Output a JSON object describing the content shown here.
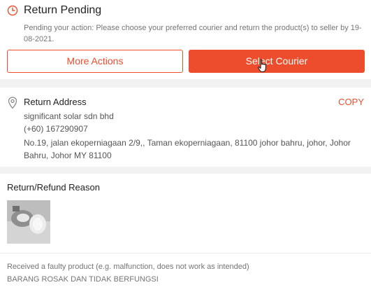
{
  "status": {
    "title": "Return Pending",
    "description": "Pending your action: Please choose your preferred courier and return the product(s) to seller by 19-08-2021.",
    "icon": "clock-icon"
  },
  "actions": {
    "more_actions_label": "More Actions",
    "select_courier_label": "Select Courier"
  },
  "address": {
    "title": "Return Address",
    "copy_label": "COPY",
    "icon": "location-pin-icon",
    "name": "significant solar sdn bhd",
    "phone": "(+60) 167290907",
    "street": "No.19, jalan ekoperniagaan 2/9,, Taman ekoperniagaan, 81100 johor bahru, johor, Johor Bahru, Johor MY 81100"
  },
  "reason": {
    "title": "Return/Refund Reason",
    "text": "Received a faulty product (e.g. malfunction, does not work as intended)",
    "note": "BARANG ROSAK DAN TIDAK BERFUNGSI"
  },
  "colors": {
    "accent": "#ee4d2d",
    "background": "#f2f2f2",
    "card": "#ffffff"
  }
}
